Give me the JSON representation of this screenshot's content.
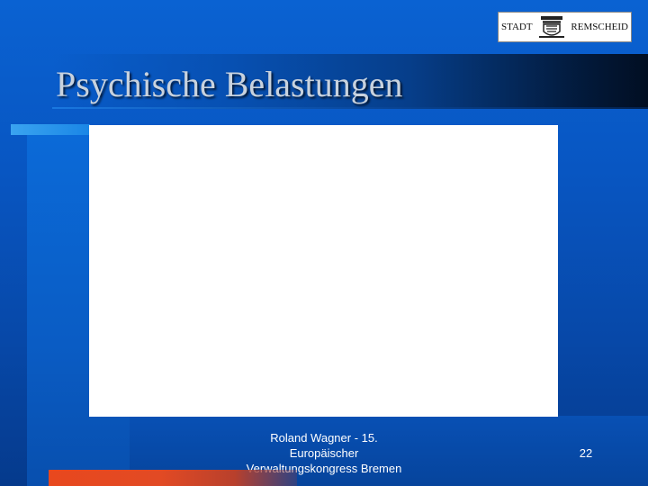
{
  "slide": {
    "title": "Psychische Belastungen",
    "page_number": "22"
  },
  "logo": {
    "left_text": "STADT",
    "right_text": "REMSCHEID"
  },
  "footer": {
    "line1": "Roland Wagner - 15.",
    "line2": "Europäischer",
    "line3": "Verwaltungskongress Bremen"
  },
  "colors": {
    "background": "#0a5cc8",
    "title_text": "#c8d2de",
    "accent_bar": "#2a96ec",
    "bottom_accent": "#e24a24",
    "content_box": "#ffffff"
  }
}
